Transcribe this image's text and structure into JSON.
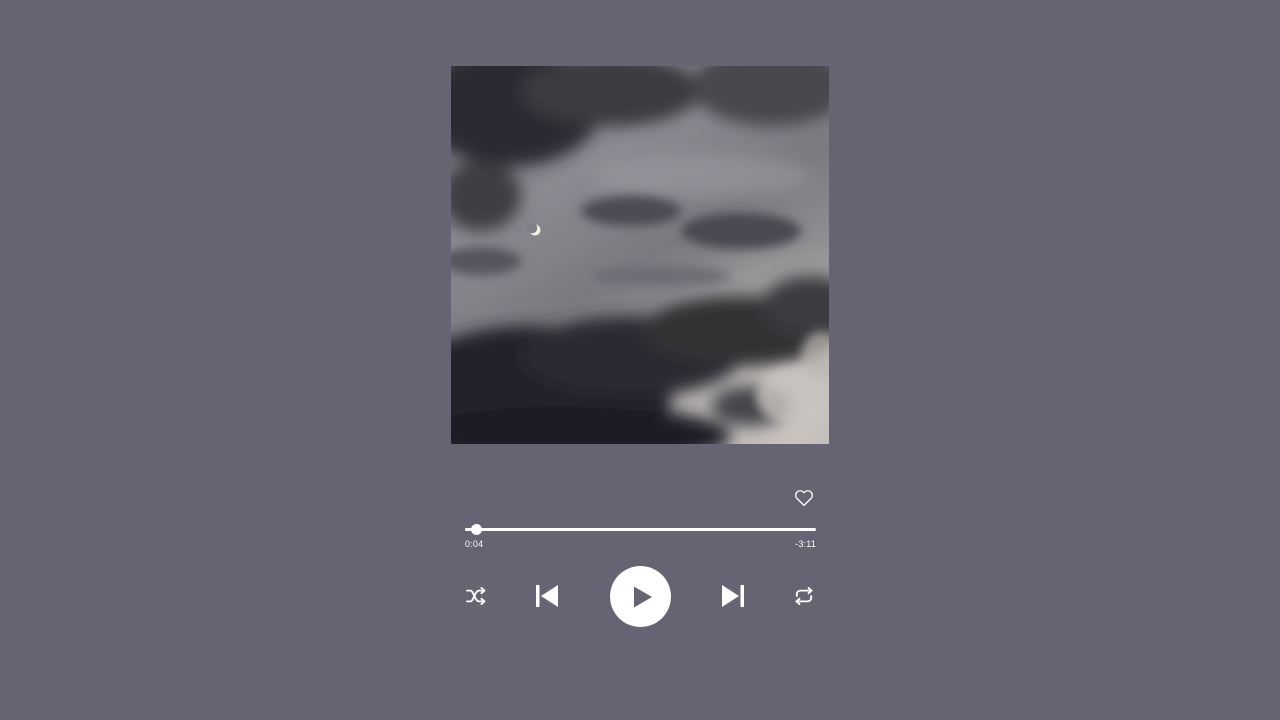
{
  "player": {
    "artwork": {
      "description_icon": "night-sky-clouds-crescent-moon-artwork"
    },
    "progress": {
      "elapsed": "0:04",
      "remaining": "-3:11",
      "fraction": 0.03
    },
    "icons": {
      "like": "heart-outline-icon",
      "shuffle": "shuffle-icon",
      "previous": "skip-previous-icon",
      "play": "play-icon",
      "next": "skip-next-icon",
      "repeat": "repeat-icon"
    },
    "colors": {
      "background": "#666373",
      "foreground": "#ffffff"
    }
  }
}
